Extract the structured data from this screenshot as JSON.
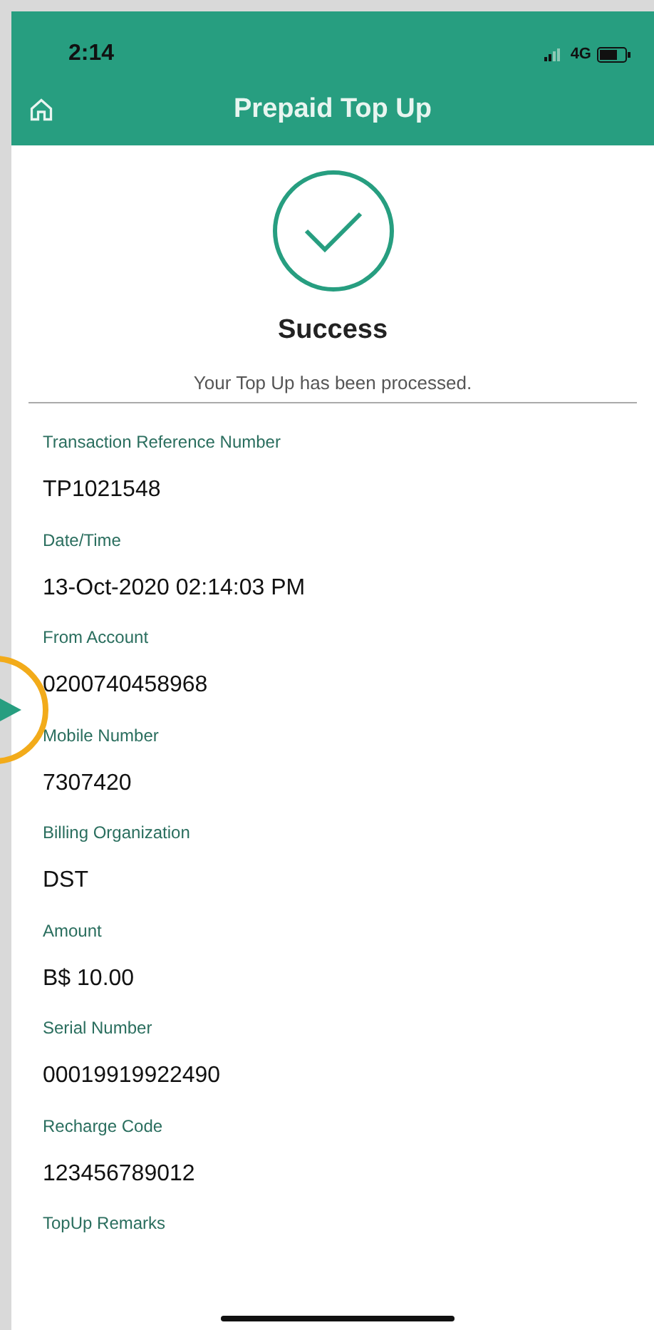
{
  "status_bar": {
    "time": "2:14",
    "network": "4G"
  },
  "header": {
    "title": "Prepaid Top Up"
  },
  "result": {
    "title": "Success",
    "message": "Your Top Up has been processed."
  },
  "fields": [
    {
      "label": "Transaction Reference Number",
      "value": "TP1021548"
    },
    {
      "label": "Date/Time",
      "value": "13-Oct-2020 02:14:03 PM"
    },
    {
      "label": "From Account",
      "value": "0200740458968"
    },
    {
      "label": "Mobile Number",
      "value": "7307420"
    },
    {
      "label": "Billing Organization",
      "value": "DST"
    },
    {
      "label": "Amount",
      "value": "B$ 10.00"
    },
    {
      "label": "Serial Number",
      "value": "00019919922490"
    },
    {
      "label": "Recharge Code",
      "value": "123456789012"
    },
    {
      "label": "TopUp Remarks"
    }
  ]
}
